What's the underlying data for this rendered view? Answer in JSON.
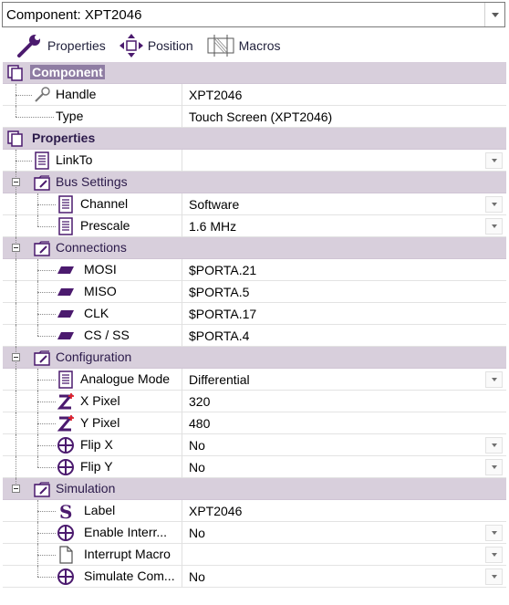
{
  "selector": {
    "text": "Component: XPT2046"
  },
  "toolbar": {
    "properties": "Properties",
    "position": "Position",
    "macros": "Macros"
  },
  "grid": {
    "component_header": "Component",
    "handle_label": "Handle",
    "handle_value": "XPT2046",
    "type_label": "Type",
    "type_value": "Touch Screen (XPT2046)",
    "properties_header": "Properties",
    "linkto_label": "LinkTo",
    "linkto_value": "",
    "bus_header": "Bus Settings",
    "channel_label": "Channel",
    "channel_value": "Software",
    "prescale_label": "Prescale",
    "prescale_value": "1.6 MHz",
    "connections_header": "Connections",
    "mosi_label": "MOSI",
    "mosi_value": "$PORTA.21",
    "miso_label": "MISO",
    "miso_value": "$PORTA.5",
    "clk_label": "CLK",
    "clk_value": "$PORTA.17",
    "cs_label": "CS / SS",
    "cs_value": "$PORTA.4",
    "configuration_header": "Configuration",
    "analogue_label": "Analogue Mode",
    "analogue_value": "Differential",
    "xpixel_label": "X Pixel",
    "xpixel_value": "320",
    "ypixel_label": "Y Pixel",
    "ypixel_value": "480",
    "flipx_label": "Flip X",
    "flipx_value": "No",
    "flipy_label": "Flip Y",
    "flipy_value": "No",
    "simulation_header": "Simulation",
    "label_label": "Label",
    "label_value": "XPT2046",
    "enable_label": "Enable Interr...",
    "enable_value": "No",
    "macro_label": "Interrupt Macro",
    "macro_value": "",
    "simulate_label": "Simulate Com...",
    "simulate_value": "No"
  },
  "colors": {
    "category_bg": "#d8cfdc",
    "icon_purple": "#4b1a6e",
    "accent_red": "#e0202a"
  }
}
